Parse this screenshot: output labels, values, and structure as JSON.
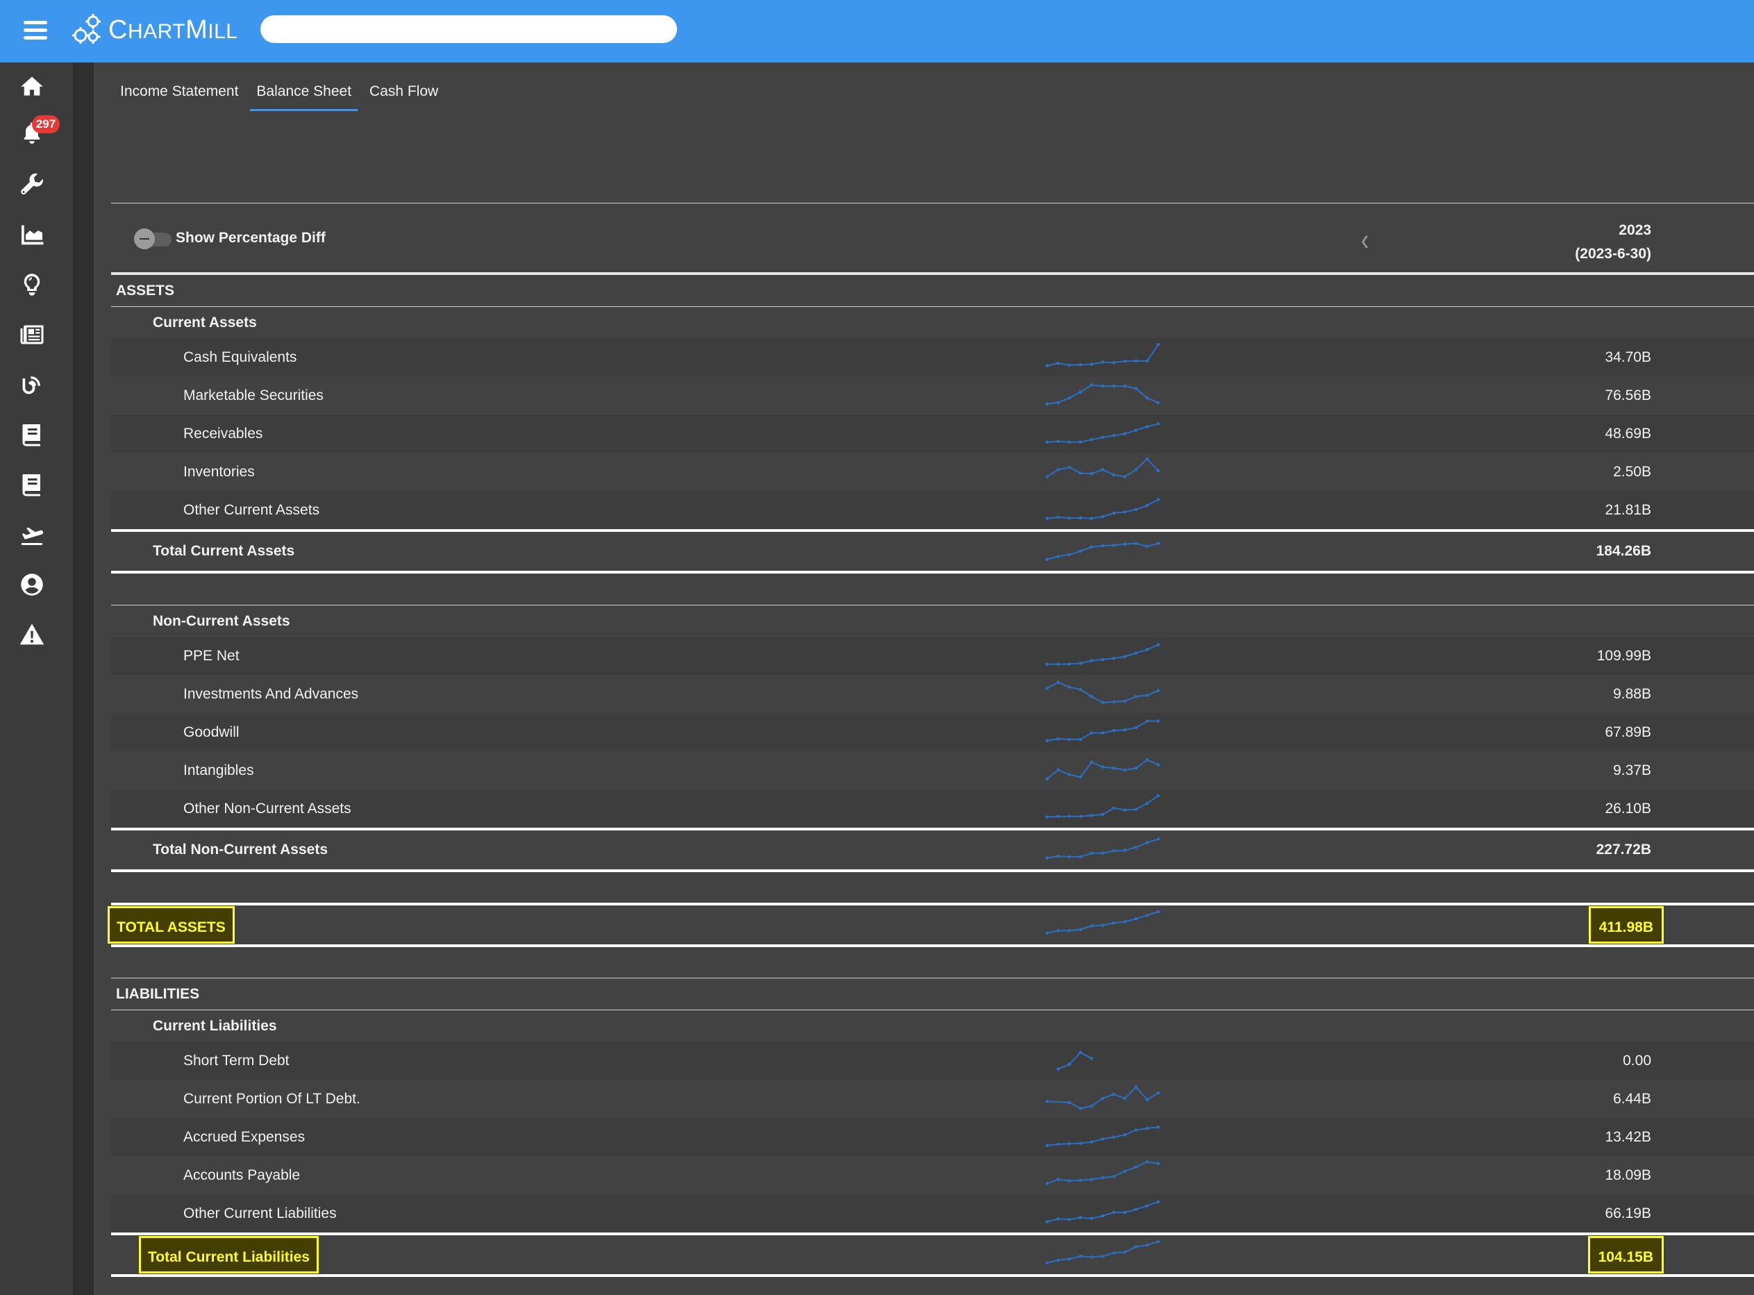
{
  "header": {
    "brand": "ChartMill",
    "brand_parts": [
      "C",
      "HART",
      "M",
      "ILL"
    ],
    "search": {
      "value": "",
      "placeholder": ""
    },
    "accent_color": "#3d97ee"
  },
  "sidebar": {
    "items": [
      {
        "icon": "home-icon"
      },
      {
        "icon": "bell-icon",
        "badge": "297"
      },
      {
        "icon": "wrench-icon"
      },
      {
        "icon": "area-chart-icon"
      },
      {
        "icon": "lightbulb-icon"
      },
      {
        "icon": "newspaper-icon"
      },
      {
        "icon": "podcast-icon"
      },
      {
        "icon": "book-icon"
      },
      {
        "icon": "book-icon"
      },
      {
        "icon": "plane-departure-icon"
      },
      {
        "icon": "user-circle-icon"
      },
      {
        "icon": "warning-icon"
      }
    ]
  },
  "tabs": [
    {
      "label": "Income Statement",
      "active": false
    },
    {
      "label": "Balance Sheet",
      "active": true
    },
    {
      "label": "Cash Flow",
      "active": false
    }
  ],
  "table": {
    "toggle_label": "Show Percentage Diff",
    "toggle_on": false,
    "period": {
      "year": "2023",
      "date": "(2023-6-30)"
    },
    "assets": {
      "title": "ASSETS",
      "current": {
        "title": "Current Assets",
        "rows": [
          {
            "label": "Cash Equivalents",
            "value": "34.70B",
            "trend": [
              2,
              4,
              2.5,
              2.8,
              3.2,
              5,
              4.6,
              5.8,
              6,
              5.9,
              20
            ]
          },
          {
            "label": "Marketable Securities",
            "value": "76.56B",
            "trend": [
              2,
              3,
              7,
              12,
              18,
              17,
              17,
              17,
              15,
              7,
              3
            ]
          },
          {
            "label": "Receivables",
            "value": "48.69B",
            "trend": [
              2,
              2.5,
              2,
              2,
              4,
              6,
              7.5,
              9,
              12,
              15,
              17.5
            ]
          },
          {
            "label": "Inventories",
            "value": "2.50B",
            "trend": [
              5,
              11,
              13,
              8,
              7.5,
              11,
              6.5,
              5,
              11,
              20,
              10
            ]
          },
          {
            "label": "Other Current Assets",
            "value": "21.81B",
            "trend": [
              2,
              3,
              2.3,
              2.4,
              2,
              3.5,
              6.5,
              7.5,
              9.5,
              13,
              18
            ]
          }
        ],
        "total": {
          "label": "Total Current Assets",
          "value": "184.26B",
          "trend": [
            2,
            4.5,
            6,
            9,
            12.5,
            13.5,
            14,
            15,
            15.5,
            13,
            15.5
          ]
        }
      },
      "noncurrent": {
        "title": "Non-Current Assets",
        "rows": [
          {
            "label": "PPE Net",
            "value": "109.99B",
            "trend": [
              2,
              2,
              2.2,
              2.8,
              5,
              6,
              7,
              8.5,
              11.5,
              14.5,
              18.5
            ]
          },
          {
            "label": "Investments And Advances",
            "value": "9.88B",
            "trend": [
              14,
              19,
              15,
              13,
              7,
              2,
              2.5,
              3,
              7,
              8,
              12
            ]
          },
          {
            "label": "Goodwill",
            "value": "67.89B",
            "trend": [
              2,
              3.5,
              3,
              3,
              8.5,
              8.5,
              10.5,
              11,
              13,
              18.5,
              18.5
            ]
          },
          {
            "label": "Intangibles",
            "value": "9.37B",
            "trend": [
              2,
              9.5,
              5.5,
              3.5,
              16,
              12,
              11,
              9.5,
              11,
              18,
              14
            ]
          },
          {
            "label": "Other Non-Current Assets",
            "value": "26.10B",
            "trend": [
              2,
              2.5,
              2.5,
              2.5,
              3.3,
              4.2,
              9.5,
              8,
              8.5,
              13.5,
              20
            ]
          }
        ],
        "total": {
          "label": "Total Non-Current Assets",
          "value": "227.72B",
          "trend": [
            2,
            3.5,
            3,
            3,
            6,
            6,
            8,
            8.5,
            11,
            15,
            18
          ]
        }
      },
      "total": {
        "label": "TOTAL ASSETS",
        "value": "411.98B",
        "trend": [
          2,
          4,
          4,
          5,
          8,
          8.5,
          10.5,
          11.5,
          14,
          17,
          20
        ],
        "highlighted": true
      }
    },
    "liabilities": {
      "title": "LIABILITIES",
      "current": {
        "title": "Current Liabilities",
        "rows": [
          {
            "label": "Short Term Debt",
            "value": "0.00",
            "trend": [
              null,
              2,
              6,
              16,
              11,
              null,
              null,
              null,
              null,
              null,
              null
            ]
          },
          {
            "label": "Current Portion Of LT Debt.",
            "value": "6.44B",
            "trend": [
              7,
              null,
              6,
              1,
              3,
              9.5,
              13,
              9.5,
              19,
              8.5,
              14
            ]
          },
          {
            "label": "Accrued Expenses",
            "value": "13.42B",
            "trend": [
              2,
              3,
              3.5,
              3.8,
              4.8,
              7.5,
              9,
              11,
              15,
              16.5,
              17.5
            ]
          },
          {
            "label": "Accounts Payable",
            "value": "18.09B",
            "trend": [
              2,
              5.5,
              4.5,
              4.8,
              5.5,
              7,
              8,
              12.5,
              16,
              20.5,
              19
            ]
          },
          {
            "label": "Other Current Liabilities",
            "value": "66.19B",
            "trend": [
              2,
              4.5,
              4,
              5.5,
              4.8,
              7,
              10,
              10,
              12.5,
              15.5,
              19
            ]
          }
        ],
        "total": {
          "label": "Total Current Liabilities",
          "value": "104.15B",
          "trend": [
            2,
            4.2,
            5.3,
            7.5,
            6.8,
            7.5,
            10.3,
            11,
            15.5,
            17,
            20
          ],
          "highlighted": true
        }
      }
    }
  },
  "colors": {
    "sparkline": "#2a6fc4",
    "highlight_text": "#ffff22",
    "highlight_bg": "#443f00",
    "badge": "#e53935"
  }
}
